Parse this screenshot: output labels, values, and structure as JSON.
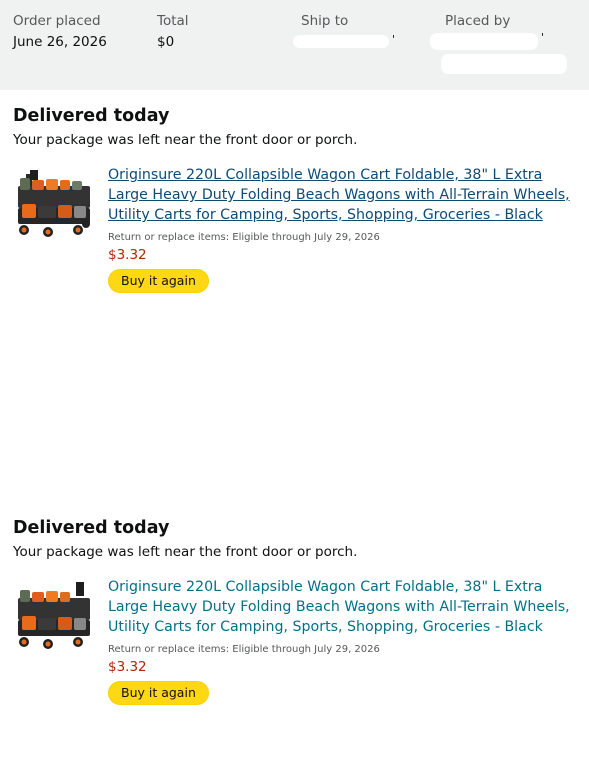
{
  "order_header": {
    "order_placed_label": "Order placed",
    "order_placed_value": "June 26, 2026",
    "total_label": "Total",
    "total_value": "$0",
    "ship_to_label": "Ship to",
    "placed_by_label": "Placed by"
  },
  "shipments": [
    {
      "status": "Delivered today",
      "status_detail": "Your package was left near the front door or porch.",
      "item": {
        "title": "Originsure 220L Collapsible Wagon Cart Foldable, 38\" L Extra Large Heavy Duty Folding Beach Wagons with All-Terrain Wheels, Utility Carts for Camping, Sports, Shopping, Groceries - Black",
        "return_note": "Return or replace items: Eligible through July 29, 2026",
        "price": "$3.32",
        "buy_again_label": "Buy it again"
      }
    },
    {
      "status": "Delivered today",
      "status_detail": "Your package was left near the front door or porch.",
      "item": {
        "title": "Originsure 220L Collapsible Wagon Cart Foldable, 38\" L Extra Large Heavy Duty Folding Beach Wagons with All-Terrain Wheels, Utility Carts for Camping, Sports, Shopping, Groceries - Black",
        "return_note": "Return or replace items: Eligible through July 29, 2026",
        "price": "$3.32",
        "buy_again_label": "Buy it again"
      }
    }
  ],
  "colors": {
    "header_bg": "#f0f2f2",
    "link": "#007185",
    "visited_link": "#0f4a75",
    "price": "#b12704",
    "button": "#ffd814"
  }
}
